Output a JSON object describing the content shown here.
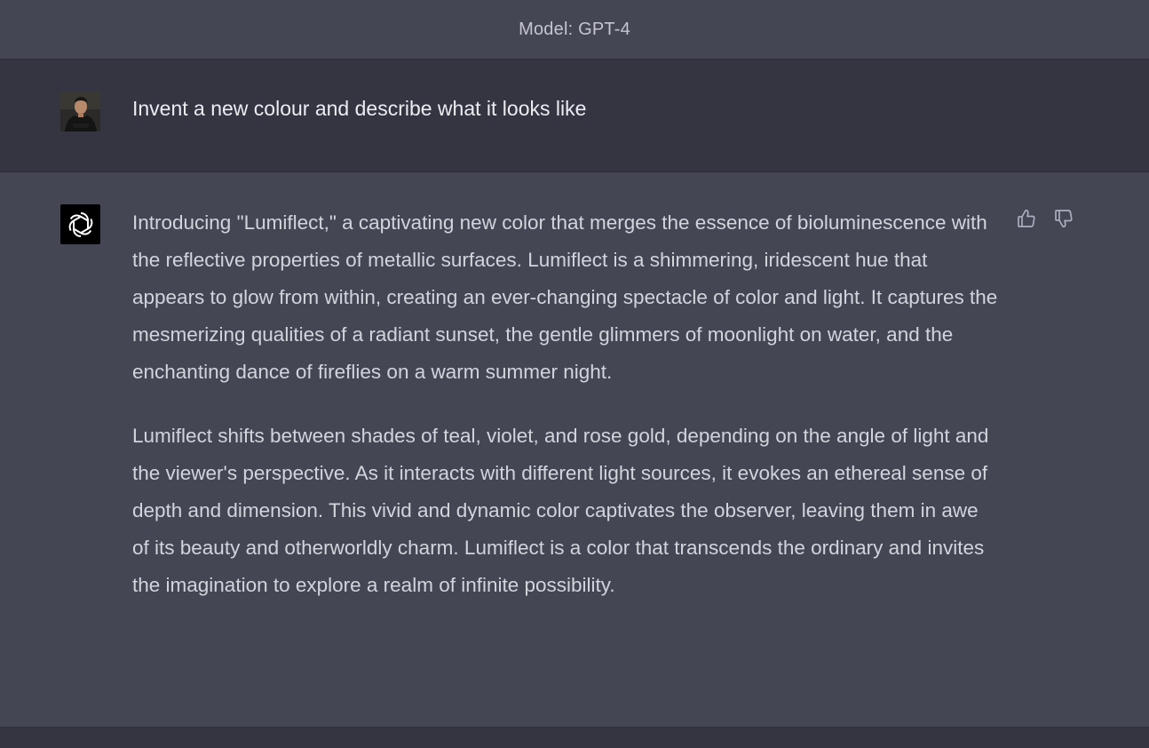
{
  "header": {
    "model_label": "Model: GPT-4"
  },
  "conversation": {
    "user": {
      "avatar_icon": "user-photo-avatar",
      "message": "Invent a new colour and describe what it looks like"
    },
    "assistant": {
      "avatar_icon": "openai-logo-icon",
      "paragraphs": [
        "Introducing \"Lumiflect,\" a captivating new color that merges the essence of bioluminescence with the reflective properties of metallic surfaces. Lumiflect is a shimmering, iridescent hue that appears to glow from within, creating an ever-changing spectacle of color and light. It captures the mesmerizing qualities of a radiant sunset, the gentle glimmers of moonlight on water, and the enchanting dance of fireflies on a warm summer night.",
        "Lumiflect shifts between shades of teal, violet, and rose gold, depending on the angle of light and the viewer's perspective. As it interacts with different light sources, it evokes an ethereal sense of depth and dimension. This vivid and dynamic color captivates the observer, leaving them in awe of its beauty and otherworldly charm. Lumiflect is a color that transcends the ordinary and invites the imagination to explore a realm of infinite possibility."
      ],
      "feedback_icons": [
        "thumbs-up-icon",
        "thumbs-down-icon"
      ]
    }
  },
  "colors": {
    "background": "#343541",
    "assistant_background": "#444654",
    "text_primary": "#ececf1",
    "text_secondary": "#d1d5db",
    "icon": "#acacbe"
  }
}
